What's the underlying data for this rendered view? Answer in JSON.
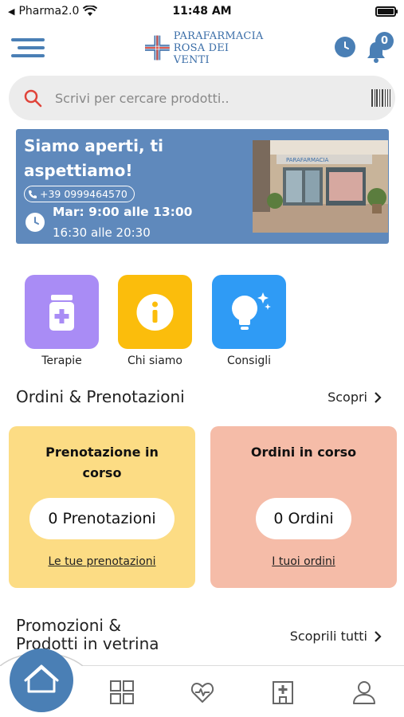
{
  "status_bar": {
    "carrier": "Pharma2.0",
    "time": "11:48 AM"
  },
  "header": {
    "logo_line1": "PARAFARMACIA",
    "logo_line2": "ROSA DEI VENTI",
    "notifications_count": "0"
  },
  "search": {
    "placeholder": "Scrivi per cercare prodotti.."
  },
  "banner": {
    "title": "Siamo aperti, ti aspettiamo!",
    "phone": "+39 0999464570",
    "hours_line1": "Mar: 9:00 alle 13:00",
    "hours_line2": "16:30 alle 20:30",
    "photo_sign": "PARAFARMACIA"
  },
  "quick_actions": [
    {
      "label": "Terapie",
      "icon": "medicine-bottle-icon",
      "color": "#a98cf5"
    },
    {
      "label": "Chi siamo",
      "icon": "info-icon",
      "color": "#fbbd0c"
    },
    {
      "label": "Consigli",
      "icon": "lightbulb-icon",
      "color": "#2f9bf5"
    }
  ],
  "orders_section": {
    "title": "Ordini & Prenotazioni",
    "link": "Scopri"
  },
  "cards": [
    {
      "title": "Prenotazione in corso",
      "count": "0 Prenotazioni",
      "link": "Le tue prenotazioni",
      "color": "#fcdc84"
    },
    {
      "title": "Ordini in corso",
      "count": "0 Ordini",
      "link": "I tuoi ordini",
      "color": "#f5bca8"
    }
  ],
  "promo_section": {
    "title_line1": "Promozioni &",
    "title_line2": "Prodotti in vetrina",
    "link": "Scoprili tutti"
  },
  "bottom_nav": [
    "home-icon",
    "grid-icon",
    "heart-pulse-icon",
    "pharmacy-icon",
    "user-icon"
  ],
  "colors": {
    "primary": "#4a7fb5",
    "banner": "#5f89bc"
  }
}
